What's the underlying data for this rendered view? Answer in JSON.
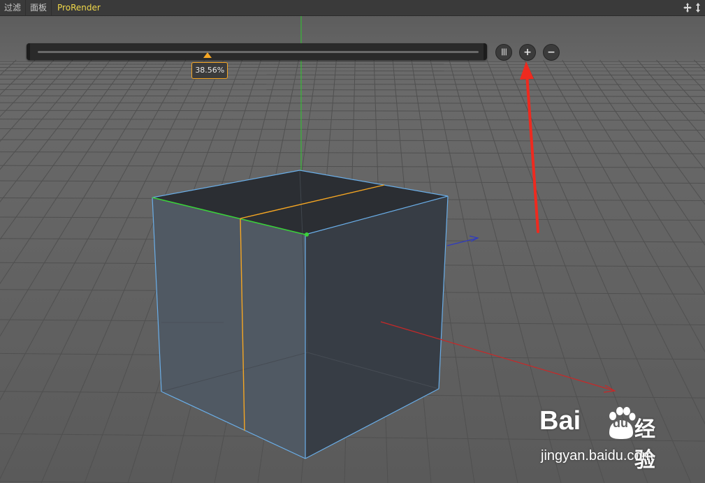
{
  "menubar": {
    "items": [
      "过滤",
      "面板",
      "ProRender"
    ]
  },
  "viewport": {
    "slider": {
      "value": 0.3856,
      "label": "38.56%"
    },
    "buttons": {
      "loop_icon": "|||",
      "add": "+",
      "remove": "−"
    },
    "colors": {
      "accent": "#f5a623",
      "selection_edge": "#3ad13a",
      "object_edge": "#6aaee8",
      "x_axis": "#c82828",
      "y_axis": "#2ec82e",
      "z_axis": "#2f3bbf",
      "annotation_arrow": "#ee2a1f"
    }
  },
  "watermark": {
    "brand_latin": "Bai",
    "brand_du": "du",
    "brand_cn": "经验",
    "url": "jingyan.baidu.com"
  }
}
